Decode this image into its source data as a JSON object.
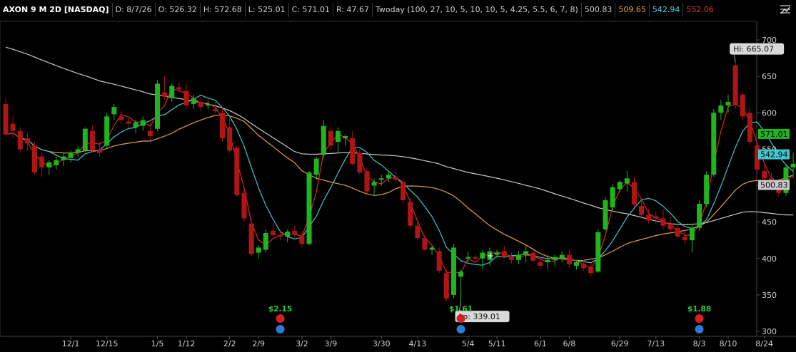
{
  "header": {
    "symbol": "AXON 9 M 2D [NASDAQ]",
    "date": "D: 8/7/26",
    "open": "O: 526.32",
    "high": "H: 572.68",
    "low": "L: 525.01",
    "close": "C: 571.01",
    "range": "R: 47.67",
    "study": "Twoday (100, 27, 10, 5, 10, 10, 5, 4.25, 5.5, 6, 7, 8)",
    "study_values": [
      "500.83",
      "509.65",
      "542.94",
      "552.06"
    ],
    "study_colors": [
      "#d0d0d0",
      "#e6a93c",
      "#4fd3d9",
      "#e03c3c"
    ]
  },
  "colors": {
    "up": "#1fb51f",
    "down": "#b01515",
    "ma_fast": "#e02424",
    "ma_mid": "#40c8d0",
    "ma_slow": "#e0a040",
    "ma_long": "#c8c8c8"
  },
  "annotations": {
    "hi_label": "Hi: 665.07",
    "lo_label": "Lo: 339.01"
  },
  "badges": [
    {
      "text": "571.01",
      "color": "#1fb51f",
      "value": 571.01
    },
    {
      "text": "542.94",
      "color": "#40c8d0",
      "value": 542.94
    },
    {
      "text": "500.83",
      "color": "#c8c8c8",
      "value": 500.83
    }
  ],
  "events": [
    {
      "amount": "$2.15",
      "index": 38
    },
    {
      "amount": "$1.61",
      "index": 63
    },
    {
      "amount": "$1.88",
      "index": 96
    }
  ],
  "chart_data": {
    "type": "candlestick",
    "ylim": [
      300,
      735
    ],
    "y_ticks": [
      300,
      350,
      400,
      450,
      500,
      550,
      600,
      650,
      700
    ],
    "x_ticks": [
      {
        "label": "12/1",
        "index": 9
      },
      {
        "label": "12/15",
        "index": 14
      },
      {
        "label": "1/5",
        "index": 21
      },
      {
        "label": "1/12",
        "index": 25
      },
      {
        "label": "2/2",
        "index": 31
      },
      {
        "label": "2/9",
        "index": 35
      },
      {
        "label": "3/2",
        "index": 41
      },
      {
        "label": "3/9",
        "index": 45
      },
      {
        "label": "3/30",
        "index": 52
      },
      {
        "label": "4/13",
        "index": 57
      },
      {
        "label": "5/4",
        "index": 64
      },
      {
        "label": "5/11",
        "index": 68
      },
      {
        "label": "6/1",
        "index": 74
      },
      {
        "label": "6/8",
        "index": 78
      },
      {
        "label": "6/29",
        "index": 85
      },
      {
        "label": "7/13",
        "index": 90
      },
      {
        "label": "8/3",
        "index": 96
      },
      {
        "label": "8/10",
        "index": 100
      },
      {
        "label": "8/24",
        "index": 105
      }
    ],
    "candles": [
      [
        612,
        620,
        571,
        570
      ],
      [
        585,
        595,
        565,
        575
      ],
      [
        575,
        580,
        545,
        550
      ],
      [
        565,
        572,
        548,
        558
      ],
      [
        555,
        560,
        515,
        518
      ],
      [
        540,
        545,
        512,
        525
      ],
      [
        525,
        535,
        515,
        532
      ],
      [
        528,
        540,
        522,
        535
      ],
      [
        535,
        545,
        527,
        540
      ],
      [
        538,
        548,
        532,
        545
      ],
      [
        545,
        555,
        540,
        550
      ],
      [
        548,
        580,
        546,
        578
      ],
      [
        575,
        582,
        545,
        548
      ],
      [
        550,
        560,
        540,
        545
      ],
      [
        555,
        600,
        552,
        595
      ],
      [
        598,
        612,
        590,
        608
      ],
      [
        595,
        602,
        586,
        590
      ],
      [
        588,
        593,
        580,
        585
      ],
      [
        580,
        590,
        572,
        587
      ],
      [
        582,
        595,
        575,
        590
      ],
      [
        575,
        585,
        562,
        568
      ],
      [
        578,
        645,
        575,
        640
      ],
      [
        628,
        650,
        618,
        622
      ],
      [
        620,
        640,
        615,
        637
      ],
      [
        635,
        642,
        628,
        632
      ],
      [
        630,
        640,
        605,
        610
      ],
      [
        612,
        625,
        605,
        620
      ],
      [
        615,
        622,
        602,
        608
      ],
      [
        610,
        618,
        605,
        612
      ],
      [
        605,
        615,
        600,
        602
      ],
      [
        600,
        608,
        560,
        565
      ],
      [
        580,
        595,
        545,
        548
      ],
      [
        552,
        556,
        485,
        487
      ],
      [
        490,
        495,
        450,
        455
      ],
      [
        448,
        455,
        403,
        406
      ],
      [
        408,
        418,
        400,
        415
      ],
      [
        412,
        440,
        408,
        435
      ],
      [
        438,
        448,
        430,
        432
      ],
      [
        432,
        440,
        425,
        430
      ],
      [
        430,
        440,
        422,
        437
      ],
      [
        438,
        445,
        428,
        433
      ],
      [
        432,
        438,
        415,
        420
      ],
      [
        420,
        520,
        418,
        518
      ],
      [
        515,
        540,
        508,
        537
      ],
      [
        542,
        590,
        538,
        582
      ],
      [
        575,
        580,
        550,
        555
      ],
      [
        560,
        580,
        545,
        575
      ],
      [
        565,
        570,
        555,
        568
      ],
      [
        565,
        575,
        528,
        530
      ],
      [
        545,
        550,
        515,
        518
      ],
      [
        520,
        525,
        490,
        492
      ],
      [
        500,
        510,
        488,
        505
      ],
      [
        508,
        515,
        500,
        510
      ],
      [
        510,
        520,
        505,
        515
      ],
      [
        512,
        518,
        505,
        508
      ],
      [
        505,
        510,
        475,
        480
      ],
      [
        478,
        482,
        440,
        445
      ],
      [
        445,
        450,
        425,
        428
      ],
      [
        428,
        432,
        410,
        412
      ],
      [
        412,
        418,
        405,
        415
      ],
      [
        410,
        415,
        380,
        383
      ],
      [
        380,
        385,
        342,
        345
      ],
      [
        350,
        420,
        345,
        415
      ],
      [
        375,
        385,
        340,
        382
      ],
      [
        400,
        410,
        395,
        402
      ],
      [
        402,
        405,
        398,
        400
      ],
      [
        400,
        412,
        385,
        408
      ],
      [
        398,
        415,
        390,
        410
      ],
      [
        405,
        412,
        400,
        408
      ],
      [
        410,
        418,
        402,
        402
      ],
      [
        402,
        408,
        393,
        398
      ],
      [
        398,
        410,
        392,
        405
      ],
      [
        405,
        418,
        395,
        410
      ],
      [
        408,
        412,
        395,
        397
      ],
      [
        395,
        402,
        385,
        390
      ],
      [
        395,
        405,
        385,
        398
      ],
      [
        398,
        405,
        390,
        402
      ],
      [
        400,
        410,
        395,
        405
      ],
      [
        405,
        412,
        388,
        392
      ],
      [
        390,
        398,
        385,
        395
      ],
      [
        393,
        398,
        383,
        387
      ],
      [
        388,
        393,
        375,
        380
      ],
      [
        382,
        440,
        380,
        436
      ],
      [
        440,
        485,
        438,
        480
      ],
      [
        470,
        502,
        465,
        498
      ],
      [
        495,
        508,
        490,
        505
      ],
      [
        503,
        520,
        492,
        510
      ],
      [
        505,
        512,
        470,
        474
      ],
      [
        472,
        480,
        455,
        460
      ],
      [
        460,
        468,
        448,
        452
      ],
      [
        458,
        465,
        448,
        455
      ],
      [
        455,
        468,
        440,
        445
      ],
      [
        448,
        458,
        435,
        440
      ],
      [
        442,
        450,
        428,
        430
      ],
      [
        430,
        440,
        420,
        425
      ],
      [
        425,
        448,
        408,
        442
      ],
      [
        442,
        480,
        438,
        475
      ],
      [
        475,
        520,
        470,
        515
      ],
      [
        515,
        605,
        512,
        600
      ],
      [
        600,
        618,
        590,
        610
      ],
      [
        610,
        625,
        600,
        615
      ],
      [
        665,
        670,
        605,
        610
      ],
      [
        625,
        628,
        590,
        595
      ],
      [
        600,
        608,
        555,
        560
      ],
      [
        555,
        560,
        518,
        522
      ],
      [
        520,
        528,
        505,
        510
      ],
      [
        510,
        518,
        495,
        498
      ],
      [
        498,
        505,
        485,
        490
      ],
      [
        490,
        528,
        486,
        525
      ],
      [
        525,
        545,
        510,
        530
      ]
    ]
  }
}
